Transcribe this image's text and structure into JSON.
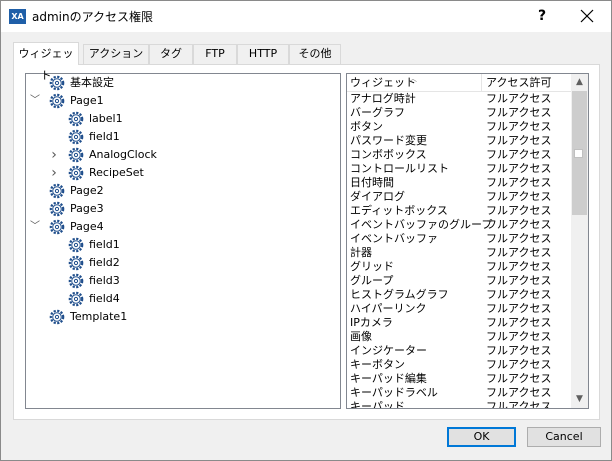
{
  "window": {
    "title": "adminのアクセス権限",
    "app_icon": "XA",
    "help_label": "?",
    "close_icon": "close-icon"
  },
  "tabs": [
    {
      "label": "ウィジェット",
      "active": true
    },
    {
      "label": "アクション",
      "active": false
    },
    {
      "label": "タグ",
      "active": false
    },
    {
      "label": "FTP",
      "active": false
    },
    {
      "label": "HTTP",
      "active": false
    },
    {
      "label": "その他",
      "active": false
    }
  ],
  "tree": {
    "items": [
      {
        "label": "基本設定",
        "level": 0,
        "expander": "none",
        "icon": "gear-icon"
      },
      {
        "label": "Page1",
        "level": 0,
        "expander": "expanded",
        "icon": "gear-icon"
      },
      {
        "label": "label1",
        "level": 1,
        "expander": "none",
        "icon": "gear-icon"
      },
      {
        "label": "field1",
        "level": 1,
        "expander": "none",
        "icon": "gear-icon"
      },
      {
        "label": "AnalogClock",
        "level": 1,
        "expander": "collapsed",
        "icon": "gear-icon"
      },
      {
        "label": "RecipeSet",
        "level": 1,
        "expander": "collapsed",
        "icon": "gear-icon"
      },
      {
        "label": "Page2",
        "level": 0,
        "expander": "none",
        "icon": "gear-icon"
      },
      {
        "label": "Page3",
        "level": 0,
        "expander": "none",
        "icon": "gear-icon"
      },
      {
        "label": "Page4",
        "level": 0,
        "expander": "expanded",
        "icon": "gear-icon"
      },
      {
        "label": "field1",
        "level": 1,
        "expander": "none",
        "icon": "gear-icon"
      },
      {
        "label": "field2",
        "level": 1,
        "expander": "none",
        "icon": "gear-icon"
      },
      {
        "label": "field3",
        "level": 1,
        "expander": "none",
        "icon": "gear-icon"
      },
      {
        "label": "field4",
        "level": 1,
        "expander": "none",
        "icon": "gear-icon"
      },
      {
        "label": "Template1",
        "level": 0,
        "expander": "none",
        "icon": "gear-icon"
      }
    ]
  },
  "list": {
    "columns": [
      "ウィジェット",
      "アクセス許可"
    ],
    "rows": [
      [
        "アナログ時計",
        "フルアクセス"
      ],
      [
        "バーグラフ",
        "フルアクセス"
      ],
      [
        "ボタン",
        "フルアクセス"
      ],
      [
        "パスワード変更",
        "フルアクセス"
      ],
      [
        "コンボボックス",
        "フルアクセス"
      ],
      [
        "コントロールリスト",
        "フルアクセス"
      ],
      [
        "日付時間",
        "フルアクセス"
      ],
      [
        "ダイアログ",
        "フルアクセス"
      ],
      [
        "エディットボックス",
        "フルアクセス"
      ],
      [
        "イベントバッファのグループ",
        "フルアクセス"
      ],
      [
        "イベントバッファ",
        "フルアクセス"
      ],
      [
        "計器",
        "フルアクセス"
      ],
      [
        "グリッド",
        "フルアクセス"
      ],
      [
        "グループ",
        "フルアクセス"
      ],
      [
        "ヒストグラムグラフ",
        "フルアクセス"
      ],
      [
        "ハイパーリンク",
        "フルアクセス"
      ],
      [
        "IPカメラ",
        "フルアクセス"
      ],
      [
        "画像",
        "フルアクセス"
      ],
      [
        "インジケーター",
        "フルアクセス"
      ],
      [
        "キーボタン",
        "フルアクセス"
      ],
      [
        "キーパッド編集",
        "フルアクセス"
      ],
      [
        "キーパッドラベル",
        "フルアクセス"
      ],
      [
        "キーパッド...",
        "フルアクセス"
      ]
    ]
  },
  "buttons": {
    "ok": "OK",
    "cancel": "Cancel"
  },
  "colors": {
    "accent": "#0078d7",
    "gear": "#1f4e8c"
  }
}
